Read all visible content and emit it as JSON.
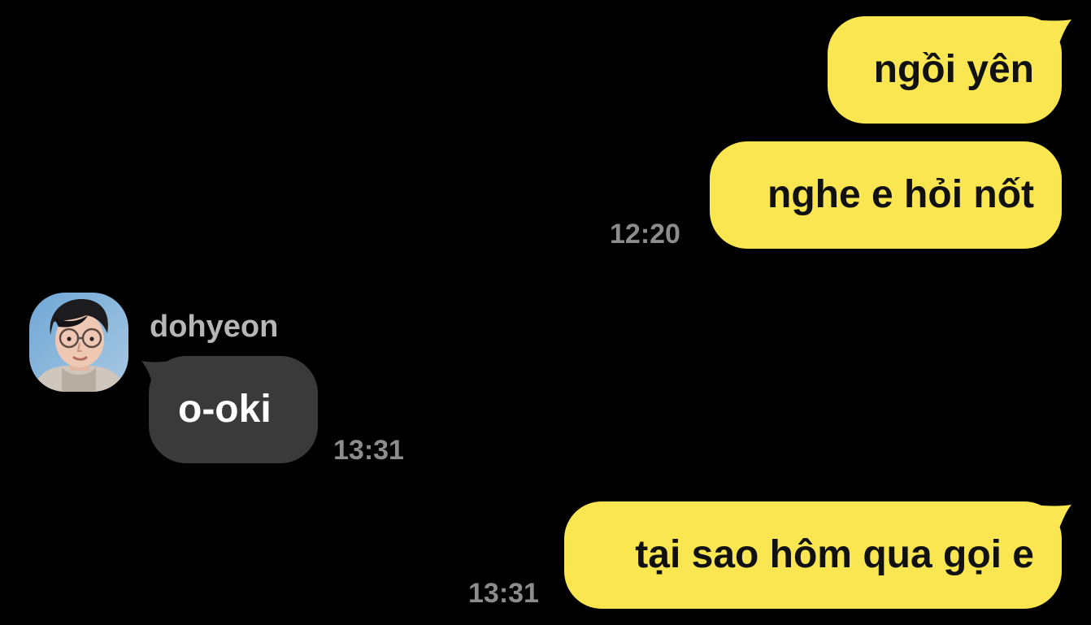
{
  "conversation": {
    "messages": [
      {
        "direction": "outgoing",
        "text": "ngồi yên",
        "time": ""
      },
      {
        "direction": "outgoing",
        "text": "nghe e hỏi nốt",
        "time": "12:20"
      },
      {
        "direction": "incoming",
        "sender": "dohyeon",
        "text": "o-oki",
        "time": "13:31"
      },
      {
        "direction": "outgoing",
        "text": "tại sao hôm qua gọi e",
        "time": "13:31"
      }
    ]
  },
  "colors": {
    "background": "#000000",
    "outgoing_bubble": "#fae650",
    "incoming_bubble": "#3a3a3a",
    "timestamp": "#8c8c8c",
    "sender_name": "#b6b6b6"
  }
}
